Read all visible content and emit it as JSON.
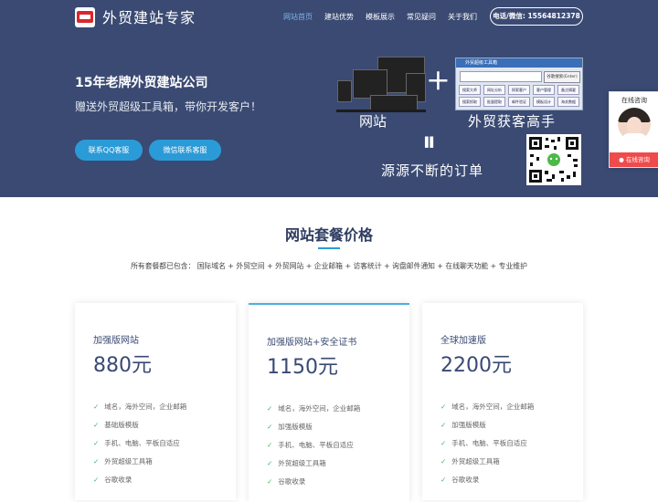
{
  "header": {
    "brand": "外贸建站专家",
    "nav": [
      "网站首页",
      "建站优势",
      "模板展示",
      "常见疑问",
      "关于我们"
    ],
    "phone": "电话/微信: 15564812378"
  },
  "hero": {
    "title": "15年老牌外贸建站公司",
    "subtitle": "赠送外贸超级工具箱，带你开发客户！",
    "buttons": [
      "联系QQ客服",
      "微信联系客服"
    ],
    "website_label": "网站",
    "tool_label": "外贸获客高手",
    "plus": "+",
    "equals": "⏸",
    "orders_label": "源源不断的订单",
    "toolbox_title": "外贸超级工具箱",
    "toolbox_search": "谷歌搜索(Enter)",
    "toolbox_cells": [
      "搜索大师",
      "网址分析",
      "探索客户",
      "客户管理",
      "备注摘要",
      "搜索抓取",
      "批量提取",
      "邮件验证",
      "模板设计",
      "海关数据"
    ]
  },
  "chat": {
    "label": "在线咨询",
    "cta": "在线咨询"
  },
  "pricing": {
    "title": "网站套餐价格",
    "includes": "所有套餐都已包含： 国际域名 + 外贸空间 + 外贸网站 + 企业邮箱 + 访客统计 + 询盘邮件通知 + 在线聊天功能 + 专业维护",
    "plans": [
      {
        "name": "加强版网站",
        "price": "880元",
        "features": [
          "域名，海外空间，企业邮箱",
          "基础版模版",
          "手机、电脑、平板自适应",
          "外贸超级工具箱",
          "谷歌收录"
        ]
      },
      {
        "name": "加强版网站+安全证书",
        "price": "1150元",
        "features": [
          "域名，海外空间，企业邮箱",
          "加强版模版",
          "手机、电脑、平板自适应",
          "外贸超级工具箱",
          "谷歌收录"
        ]
      },
      {
        "name": "全球加速版",
        "price": "2200元",
        "features": [
          "域名，海外空间，企业邮箱",
          "加强版模版",
          "手机、电脑、平板自适应",
          "外贸超级工具箱",
          "谷歌收录"
        ]
      }
    ]
  },
  "colors": {
    "header_bg": "#3a4a73",
    "accent": "#2b9bd8",
    "check": "#44b060"
  }
}
